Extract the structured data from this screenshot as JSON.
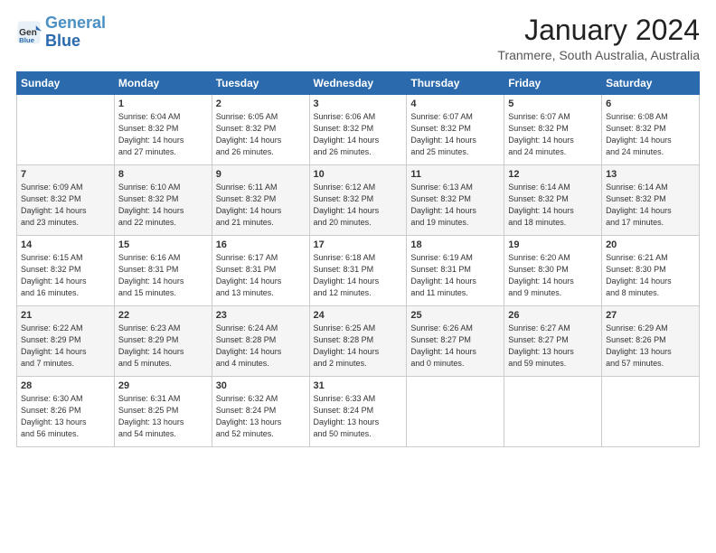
{
  "header": {
    "logo_line1": "General",
    "logo_line2": "Blue",
    "month_year": "January 2024",
    "location": "Tranmere, South Australia, Australia"
  },
  "days_of_week": [
    "Sunday",
    "Monday",
    "Tuesday",
    "Wednesday",
    "Thursday",
    "Friday",
    "Saturday"
  ],
  "weeks": [
    [
      {
        "day": "",
        "info": ""
      },
      {
        "day": "1",
        "info": "Sunrise: 6:04 AM\nSunset: 8:32 PM\nDaylight: 14 hours\nand 27 minutes."
      },
      {
        "day": "2",
        "info": "Sunrise: 6:05 AM\nSunset: 8:32 PM\nDaylight: 14 hours\nand 26 minutes."
      },
      {
        "day": "3",
        "info": "Sunrise: 6:06 AM\nSunset: 8:32 PM\nDaylight: 14 hours\nand 26 minutes."
      },
      {
        "day": "4",
        "info": "Sunrise: 6:07 AM\nSunset: 8:32 PM\nDaylight: 14 hours\nand 25 minutes."
      },
      {
        "day": "5",
        "info": "Sunrise: 6:07 AM\nSunset: 8:32 PM\nDaylight: 14 hours\nand 24 minutes."
      },
      {
        "day": "6",
        "info": "Sunrise: 6:08 AM\nSunset: 8:32 PM\nDaylight: 14 hours\nand 24 minutes."
      }
    ],
    [
      {
        "day": "7",
        "info": "Sunrise: 6:09 AM\nSunset: 8:32 PM\nDaylight: 14 hours\nand 23 minutes."
      },
      {
        "day": "8",
        "info": "Sunrise: 6:10 AM\nSunset: 8:32 PM\nDaylight: 14 hours\nand 22 minutes."
      },
      {
        "day": "9",
        "info": "Sunrise: 6:11 AM\nSunset: 8:32 PM\nDaylight: 14 hours\nand 21 minutes."
      },
      {
        "day": "10",
        "info": "Sunrise: 6:12 AM\nSunset: 8:32 PM\nDaylight: 14 hours\nand 20 minutes."
      },
      {
        "day": "11",
        "info": "Sunrise: 6:13 AM\nSunset: 8:32 PM\nDaylight: 14 hours\nand 19 minutes."
      },
      {
        "day": "12",
        "info": "Sunrise: 6:14 AM\nSunset: 8:32 PM\nDaylight: 14 hours\nand 18 minutes."
      },
      {
        "day": "13",
        "info": "Sunrise: 6:14 AM\nSunset: 8:32 PM\nDaylight: 14 hours\nand 17 minutes."
      }
    ],
    [
      {
        "day": "14",
        "info": "Sunrise: 6:15 AM\nSunset: 8:32 PM\nDaylight: 14 hours\nand 16 minutes."
      },
      {
        "day": "15",
        "info": "Sunrise: 6:16 AM\nSunset: 8:31 PM\nDaylight: 14 hours\nand 15 minutes."
      },
      {
        "day": "16",
        "info": "Sunrise: 6:17 AM\nSunset: 8:31 PM\nDaylight: 14 hours\nand 13 minutes."
      },
      {
        "day": "17",
        "info": "Sunrise: 6:18 AM\nSunset: 8:31 PM\nDaylight: 14 hours\nand 12 minutes."
      },
      {
        "day": "18",
        "info": "Sunrise: 6:19 AM\nSunset: 8:31 PM\nDaylight: 14 hours\nand 11 minutes."
      },
      {
        "day": "19",
        "info": "Sunrise: 6:20 AM\nSunset: 8:30 PM\nDaylight: 14 hours\nand 9 minutes."
      },
      {
        "day": "20",
        "info": "Sunrise: 6:21 AM\nSunset: 8:30 PM\nDaylight: 14 hours\nand 8 minutes."
      }
    ],
    [
      {
        "day": "21",
        "info": "Sunrise: 6:22 AM\nSunset: 8:29 PM\nDaylight: 14 hours\nand 7 minutes."
      },
      {
        "day": "22",
        "info": "Sunrise: 6:23 AM\nSunset: 8:29 PM\nDaylight: 14 hours\nand 5 minutes."
      },
      {
        "day": "23",
        "info": "Sunrise: 6:24 AM\nSunset: 8:28 PM\nDaylight: 14 hours\nand 4 minutes."
      },
      {
        "day": "24",
        "info": "Sunrise: 6:25 AM\nSunset: 8:28 PM\nDaylight: 14 hours\nand 2 minutes."
      },
      {
        "day": "25",
        "info": "Sunrise: 6:26 AM\nSunset: 8:27 PM\nDaylight: 14 hours\nand 0 minutes."
      },
      {
        "day": "26",
        "info": "Sunrise: 6:27 AM\nSunset: 8:27 PM\nDaylight: 13 hours\nand 59 minutes."
      },
      {
        "day": "27",
        "info": "Sunrise: 6:29 AM\nSunset: 8:26 PM\nDaylight: 13 hours\nand 57 minutes."
      }
    ],
    [
      {
        "day": "28",
        "info": "Sunrise: 6:30 AM\nSunset: 8:26 PM\nDaylight: 13 hours\nand 56 minutes."
      },
      {
        "day": "29",
        "info": "Sunrise: 6:31 AM\nSunset: 8:25 PM\nDaylight: 13 hours\nand 54 minutes."
      },
      {
        "day": "30",
        "info": "Sunrise: 6:32 AM\nSunset: 8:24 PM\nDaylight: 13 hours\nand 52 minutes."
      },
      {
        "day": "31",
        "info": "Sunrise: 6:33 AM\nSunset: 8:24 PM\nDaylight: 13 hours\nand 50 minutes."
      },
      {
        "day": "",
        "info": ""
      },
      {
        "day": "",
        "info": ""
      },
      {
        "day": "",
        "info": ""
      }
    ]
  ]
}
